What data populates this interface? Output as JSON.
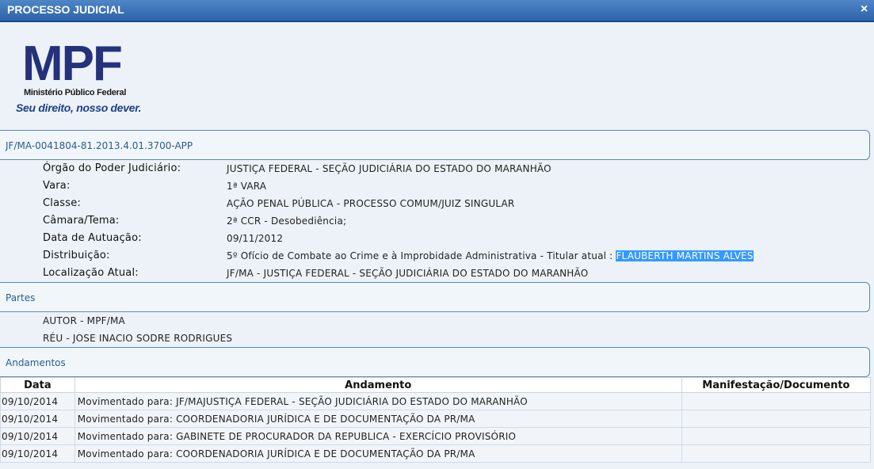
{
  "window": {
    "title": "PROCESSO JUDICIAL",
    "close_label": "×"
  },
  "logo": {
    "mpf": "MPF",
    "subtitle": "Ministério Público Federal",
    "slogan": "Seu direito, nosso dever."
  },
  "process": {
    "number": "JF/MA-0041804-81.2013.4.01.3700-APP",
    "fields": [
      {
        "label": "Órgão do Poder Judiciário:",
        "value": "JUSTIÇA FEDERAL - SEÇÃO JUDICIÁRIA DO ESTADO DO MARANHÃO"
      },
      {
        "label": "Vara:",
        "value": "1ª VARA"
      },
      {
        "label": "Classe:",
        "value": "AÇÃO PENAL PÚBLICA - PROCESSO COMUM/JUIZ SINGULAR"
      },
      {
        "label": "Câmara/Tema:",
        "value": "2ª CCR - Desobediência;"
      },
      {
        "label": "Data de Autuação:",
        "value": "09/11/2012"
      },
      {
        "label": "Distribuição:",
        "value": "5º Ofício de Combate ao Crime e à Improbidade Administrativa - Titular atual : ",
        "highlight": "FLAUBERTH MARTINS ALVES"
      },
      {
        "label": "Localização Atual:",
        "value": "JF/MA - JUSTIÇA FEDERAL - SEÇÃO JUDICIÁRIA DO ESTADO DO MARANHÃO"
      }
    ]
  },
  "partes": {
    "header": "Partes",
    "items": [
      "AUTOR - MPF/MA",
      "RÉU - JOSE INACIO SODRE RODRIGUES"
    ]
  },
  "andamentos": {
    "header": "Andamentos",
    "columns": [
      "Data",
      "Andamento",
      "Manifestação/Documento"
    ],
    "rows": [
      {
        "date": "09/10/2014",
        "andamento": "Movimentado para: JF/MAJUSTIÇA FEDERAL - SEÇÃO JUDICIÁRIA DO ESTADO DO MARANHÃO",
        "doc": ""
      },
      {
        "date": "09/10/2014",
        "andamento": "Movimentado para: COORDENADORIA JURÍDICA E DE DOCUMENTAÇÃO DA PR/MA",
        "doc": ""
      },
      {
        "date": "09/10/2014",
        "andamento": "Movimentado para: GABINETE DE PROCURADOR DA REPUBLICA - EXERCÍCIO PROVISÓRIO",
        "doc": ""
      },
      {
        "date": "09/10/2014",
        "andamento": "Movimentado para: COORDENADORIA JURÍDICA E DE DOCUMENTAÇÃO DA PR/MA",
        "doc": ""
      }
    ]
  }
}
